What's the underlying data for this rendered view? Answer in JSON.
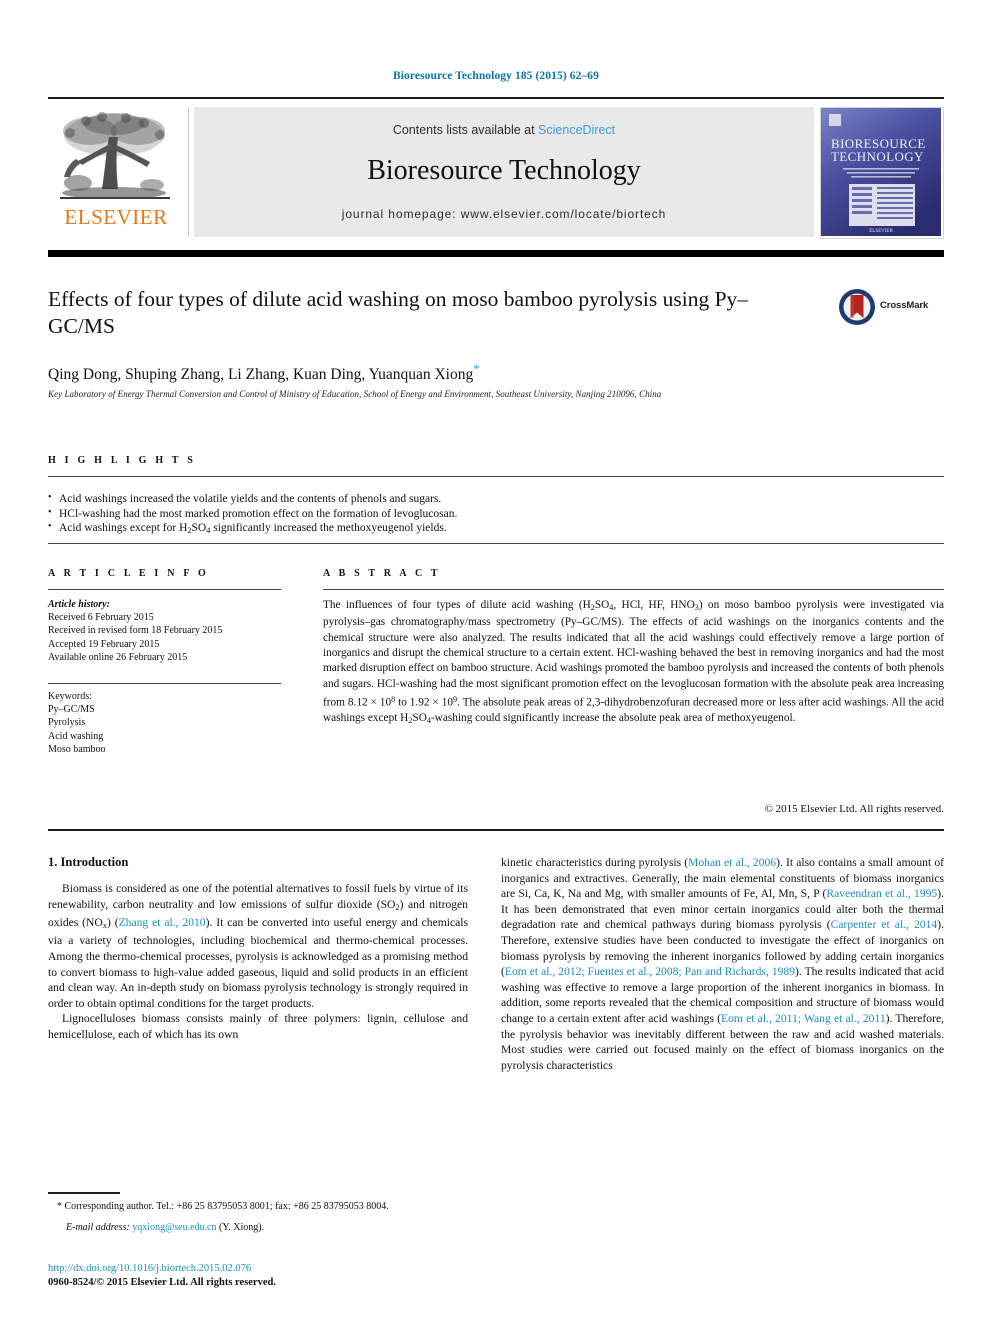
{
  "running_head": "Bioresource Technology 185 (2015) 62–69",
  "masthead": {
    "publisher_name": "ELSEVIER",
    "contents_prefix": "Contents lists available at ",
    "contents_link": "ScienceDirect",
    "journal_title": "Bioresource Technology",
    "homepage": "journal homepage: www.elsevier.com/locate/biortech",
    "cover_title_line1": "BIORESOURCE",
    "cover_title_line2": "TECHNOLOGY"
  },
  "article": {
    "title": "Effects of four types of dilute acid washing on moso bamboo pyrolysis using Py–GC/MS",
    "crossmark_label": "CrossMark",
    "authors": "Qing Dong, Shuping Zhang, Li Zhang, Kuan Ding, Yuanquan Xiong",
    "corresponding_star": "*",
    "affiliation": "Key Laboratory of Energy Thermal Conversion and Control of Ministry of Education, School of Energy and Environment, Southeast University, Nanjing 210096, China"
  },
  "highlights": {
    "heading": "H I G H L I G H T S",
    "items": [
      "Acid washings increased the volatile yields and the contents of phenols and sugars.",
      "HCl-washing had the most marked promotion effect on the formation of levoglucosan.",
      "Acid washings except for H2SO4 significantly increased the methoxyeugenol yields."
    ]
  },
  "article_info": {
    "heading": "A R T I C L E  I N F O",
    "history_label": "Article history:",
    "history": [
      "Received 6 February 2015",
      "Received in revised form 18 February 2015",
      "Accepted 19 February 2015",
      "Available online 26 February 2015"
    ],
    "keywords_label": "Keywords:",
    "keywords": [
      "Py–GC/MS",
      "Pyrolysis",
      "Acid washing",
      "Moso bamboo"
    ]
  },
  "abstract": {
    "heading": "A B S T R A C T",
    "copyright": "© 2015 Elsevier Ltd. All rights reserved."
  },
  "body": {
    "section1_title": "1. Introduction",
    "left_para1_lead": "Biomass is considered as one of the potential alternatives to fossil fuels by virtue of its renewability, carbon neutrality and low emissions of sulfur dioxide (SO",
    "left_ref_zhang": "Zhang et al., 2010",
    "left_para1_tail": "). It can be converted into useful energy and chemicals via a variety of technologies, including biochemical and thermo-chemical processes. Among the thermo-chemical processes, pyrolysis is acknowledged as a promising method to convert biomass to high-value added gaseous, liquid and solid products in an efficient and clean way. An in-depth study on biomass pyrolysis technology is strongly required in order to obtain optimal conditions for the target products.",
    "left_para2": "Lignocelluloses biomass consists mainly of three polymers: lignin, cellulose and hemicellulose, each of which has its own",
    "right_lead": "kinetic characteristics during pyrolysis (",
    "right_ref_mohan": "Mohan et al., 2006",
    "right_seg1": "). It also contains a small amount of inorganics and extractives. Generally, the main elemental constituents of biomass inorganics are Si, Ca, K, Na and Mg, with smaller amounts of Fe, Al, Mn, S, P (",
    "right_ref_raveendran": "Raveendran et al., 1995",
    "right_seg2": "). It has been demonstrated that even minor certain inorganics could alter both the thermal degradation rate and chemical pathways during biomass pyrolysis (",
    "right_ref_carpenter": "Carpenter et al., 2014",
    "right_seg3": "). Therefore, extensive studies have been conducted to investigate the effect of inorganics on biomass pyrolysis by removing the inherent inorganics followed by adding certain inorganics (",
    "right_ref_eom2012": "Eom et al., 2012; Fuentes et al., 2008; Pan and Richards, 1989",
    "right_seg4": "). The results indicated that acid washing was effective to remove a large proportion of the inherent inorganics in biomass. In addition, some reports revealed that the chemical composition and structure of biomass would change to a certain extent after acid washings (",
    "right_ref_eom2011": "Eom et al., 2011; Wang et al., 2011",
    "right_seg5": "). Therefore, the pyrolysis behavior was inevitably different between the raw and acid washed materials. Most studies were carried out focused mainly on the effect of biomass inorganics on the pyrolysis characteristics"
  },
  "footnote": {
    "corresponding": "* Corresponding author. Tel.: +86 25 83795053 8001; fax: +86 25 83795053 8004.",
    "email_label": "E-mail address:",
    "email": "yqxiong@seu.edu.cn",
    "email_suffix": " (Y. Xiong).",
    "doi": "http://dx.doi.org/10.1016/j.biortech.2015.02.076",
    "issn_line": "0960-8524/© 2015 Elsevier Ltd. All rights reserved."
  },
  "colors": {
    "link_blue": "#1a8fc1",
    "sciencedirect_blue": "#3a9cd1",
    "elsevier_orange": "#E8761A",
    "crossmark_red": "#B3251E",
    "crossmark_blue": "#1F3A6E"
  }
}
